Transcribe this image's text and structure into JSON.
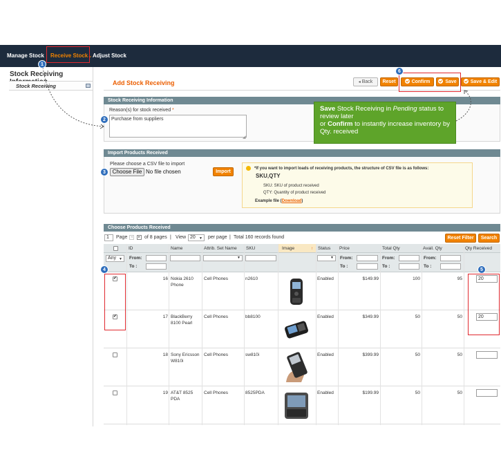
{
  "nav": {
    "items": [
      {
        "label": "Manage Stock"
      },
      {
        "label": "Receive Stock"
      },
      {
        "label": "Adjust Stock"
      }
    ],
    "dropdown_glyph": "⌄"
  },
  "sidebar": {
    "title": "Stock Receiving Information",
    "item_label": "Stock Receiving"
  },
  "page": {
    "title": "Add Stock Receiving",
    "buttons": {
      "back": "Back",
      "reset": "Reset",
      "confirm": "Confirm",
      "save": "Save",
      "save_edit": "Save & Edit"
    }
  },
  "receiving_info": {
    "header": "Stock Receiving Information",
    "reason_label": "Reason(s) for stock received",
    "required_mark": "*",
    "reason_value": "Purchase from suppliers"
  },
  "import": {
    "header": "Import Products Received",
    "prompt": "Please choose a CSV file to import",
    "choose_label": "Choose File",
    "no_file": "No file chosen",
    "import_button": "Import",
    "note_line1": "*If you want to import loads of receiving products, the structure of CSV file is as follows:",
    "note_struct": "SKU,QTY",
    "note_sku": "SKU: SKU of product received",
    "note_qty": "QTY: Quantity of product received",
    "example_prefix": "Example file (",
    "example_link": "Download",
    "example_suffix": ")"
  },
  "callout": {
    "save_word": "Save",
    "text1": " Stock Receiving in ",
    "pending": "Pending",
    "text2": " status to review later",
    "or_word": "or ",
    "confirm_word": "Confirm",
    "text3": " to instantly increase inventory by Qty. received"
  },
  "grid": {
    "header": "Choose Products Received",
    "pager": {
      "page_value": "1",
      "page_label": "Page",
      "of_pages": "of 8 pages",
      "sep1": "|",
      "view_label": "View",
      "per_page_value": "20",
      "per_page_label": "per page",
      "sep2": "|",
      "total": "Total 160 records found",
      "reset_filter": "Reset Filter",
      "search": "Search"
    },
    "columns": [
      "ID",
      "Name",
      "Attrib. Set Name",
      "SKU",
      "Image",
      "Status",
      "Price",
      "Total Qty",
      "Avail. Qty",
      "Qty Received"
    ],
    "filter": {
      "any": "Any",
      "from": "From:",
      "to": "To :"
    },
    "rows": [
      {
        "checked": true,
        "id": "16",
        "name": "Nokia 2610 Phone",
        "set": "Cell Phones",
        "sku": "n2610",
        "status": "Enabled",
        "price": "$149.99",
        "total": "100",
        "avail": "95",
        "qty": "20"
      },
      {
        "checked": true,
        "id": "17",
        "name": "BlackBerry 8100 Pearl",
        "set": "Cell Phones",
        "sku": "bb8100",
        "status": "Enabled",
        "price": "$349.99",
        "total": "50",
        "avail": "50",
        "qty": "20"
      },
      {
        "checked": false,
        "id": "18",
        "name": "Sony Ericsson W810i",
        "set": "Cell Phones",
        "sku": "sw810i",
        "status": "Enabled",
        "price": "$399.99",
        "total": "50",
        "avail": "50",
        "qty": ""
      },
      {
        "checked": false,
        "id": "19",
        "name": "AT&T 8525 PDA",
        "set": "Cell Phones",
        "sku": "8525PDA",
        "status": "Enabled",
        "price": "$199.99",
        "total": "50",
        "avail": "50",
        "qty": ""
      }
    ]
  },
  "annotations": [
    "1",
    "2",
    "3",
    "4",
    "5",
    "6"
  ],
  "colors": {
    "nav_bg": "#1d2b3d",
    "accent_orange": "#f18200",
    "section_header": "#6f8992",
    "callout_green": "#5ea42a",
    "annotation_red": "#e0282e",
    "bubble_blue": "#2f6ebc"
  }
}
